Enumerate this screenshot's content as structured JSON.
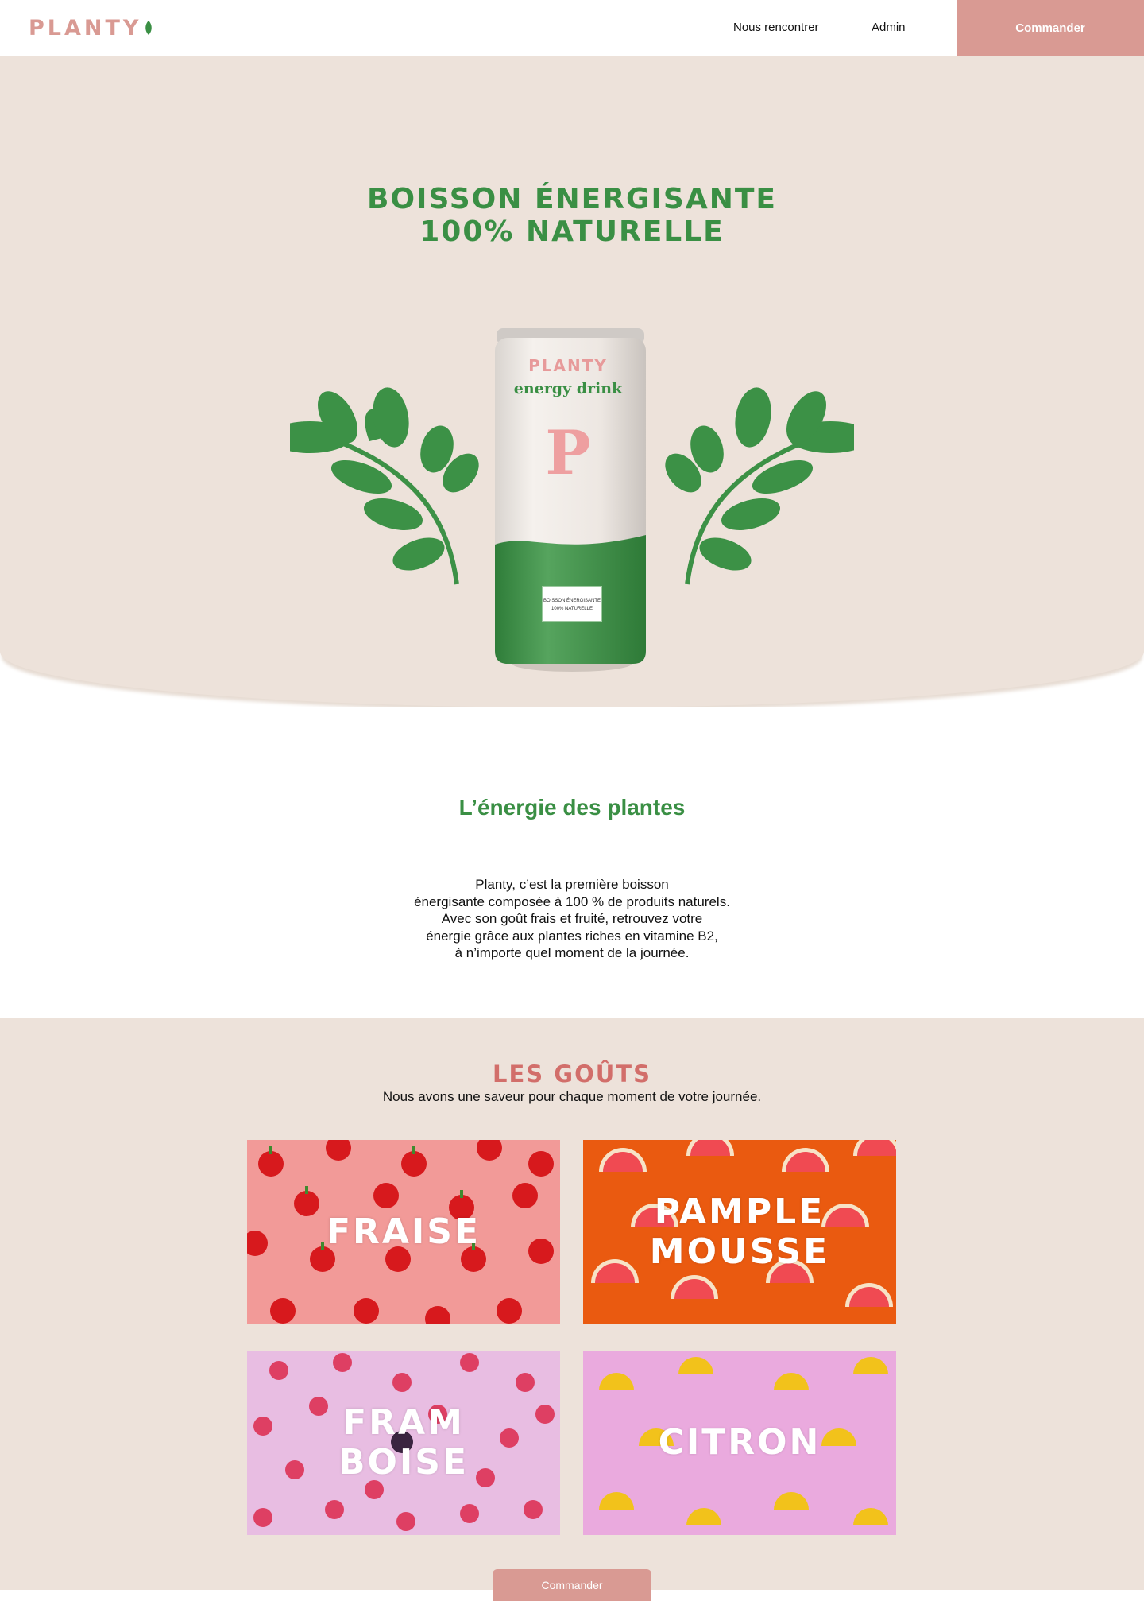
{
  "header": {
    "logo": "PLANTY",
    "nav": [
      "Nous rencontrer",
      "Admin"
    ],
    "order_label": "Commander"
  },
  "hero": {
    "title_line1": "BOISSON ÉNERGISANTE",
    "title_line2": "100% NATURELLE",
    "can": {
      "brand": "PLANTY",
      "subtitle": "energy drink",
      "letter": "P",
      "label_line1": "BOISSON ÉNERGISANTE",
      "label_line2": "100% NATURELLE"
    }
  },
  "energy": {
    "title": "L’énergie des plantes",
    "lines": [
      "Planty, c’est la première boisson",
      "énergisante composée à 100 % de produits naturels.",
      "Avec son goût frais et fruité, retrouvez votre",
      "énergie grâce aux plantes riches en vitamine B2,",
      "à n’importe quel moment de la journée."
    ]
  },
  "tastes": {
    "title": "LES GOÛTS",
    "subtitle": "Nous avons une saveur pour chaque moment de votre journée.",
    "items": [
      {
        "lines": [
          "FRAISE"
        ],
        "bg": "#f29a98",
        "fruit": "strawberry-icon"
      },
      {
        "lines": [
          "PAMPLE",
          "MOUSSE"
        ],
        "bg": "#ea5a10",
        "fruit": "grapefruit-icon"
      },
      {
        "lines": [
          "FRAM",
          "BOISE"
        ],
        "bg": "#e8bde2",
        "fruit": "raspberry-icon"
      },
      {
        "lines": [
          "CITRON"
        ],
        "bg": "#eaaade",
        "fruit": "lemon-icon"
      }
    ],
    "order_label": "Commander"
  },
  "colors": {
    "brand_pink": "#d99a93",
    "brand_green": "#3a8f44",
    "beige": "#ede2da",
    "tastes_title": "#d26e6a"
  }
}
